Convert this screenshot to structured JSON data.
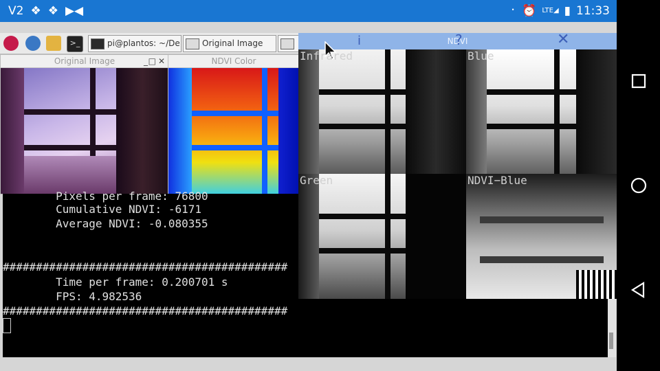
{
  "status_bar": {
    "notifications": [
      "V2",
      "app-icon-1",
      "app-icon-2",
      "bowtie-icon"
    ],
    "time": "11:33",
    "signal_label": "LTE"
  },
  "taskbar": {
    "buttons": [
      {
        "label": "pi@plantos: ~/De..."
      },
      {
        "label": "Original Image"
      }
    ]
  },
  "windows": {
    "original_image_title": "Original Image",
    "ndvi_color_title": "NDVI Color",
    "ndvi_title": "NDVI"
  },
  "ndvi_panes": {
    "infrared": "Infrared",
    "blue": "Blue",
    "green": "Green",
    "ndvi_blue": "NDVI−Blue"
  },
  "terminal": {
    "lines": [
      "        Pixels per frame: 76800",
      "        Cumulative NDVI: -6171",
      "        Average NDVI: -0.080355",
      "",
      "###########################################",
      "        Time per frame: 0.200701 s",
      "        FPS: 4.982536",
      "###########################################"
    ]
  },
  "colors": {
    "status_bar": "#1976d2",
    "ndvi_title_bar": "#8fb4e8",
    "terminal_bg": "#000000",
    "terminal_text": "#e0e0e0"
  }
}
